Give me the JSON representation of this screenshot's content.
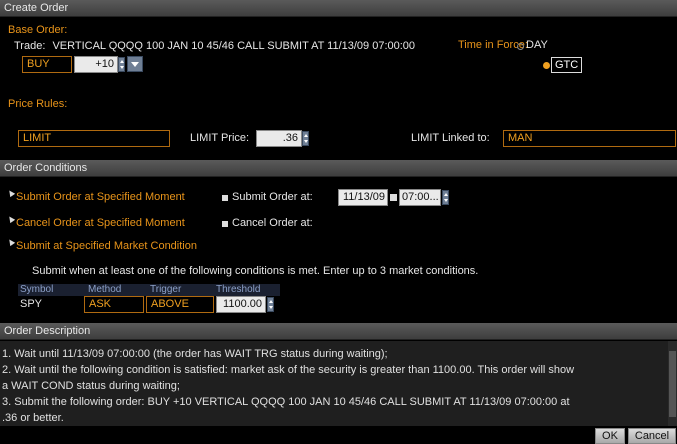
{
  "window": {
    "title": "Create Order"
  },
  "base_order": {
    "section_label": "Base Order:",
    "trade_label": "Trade:",
    "trade_text": "VERTICAL QQQQ 100 JAN 10 45/46 CALL SUBMIT AT 11/13/09 07:00:00",
    "action": "BUY",
    "quantity": "+10",
    "time_in_force_label": "Time in Force:",
    "tif_options": [
      "DAY",
      "GTC"
    ],
    "tif_selected": "GTC"
  },
  "price_rules": {
    "section_label": "Price Rules:",
    "order_type": "LIMIT",
    "limit_price_label": "LIMIT Price:",
    "limit_price": ".36",
    "linked_label": "LIMIT Linked to:",
    "linked_value": "MAN"
  },
  "order_conditions": {
    "title": "Order Conditions",
    "submit_at_moment": "Submit Order at Specified Moment",
    "submit_order_at_label": "Submit Order at:",
    "submit_date": "11/13/09",
    "submit_time": "07:00...",
    "cancel_at_moment": "Cancel Order at Specified Moment",
    "cancel_order_at_label": "Cancel Order at:",
    "submit_market_condition": "Submit at Specified Market Condition",
    "condition_instructions": "Submit when at least one of the following conditions is met. Enter up to 3 market conditions.",
    "table_headers": [
      "Symbol",
      "Method",
      "Trigger",
      "Threshold"
    ],
    "table_rows": [
      {
        "symbol": "SPY",
        "method": "ASK",
        "trigger": "ABOVE",
        "threshold": "1100.00"
      }
    ]
  },
  "order_description": {
    "title": "Order Description",
    "lines": [
      "1.  Wait until 11/13/09 07:00:00 (the order has WAIT TRG status during waiting);",
      "2.  Wait until the following condition is satisfied: market ask of the security is greater than 1100.00. This order will show",
      "a WAIT COND status during waiting;",
      "3.  Submit the following order: BUY +10 VERTICAL QQQQ 100 JAN 10 45/46 CALL SUBMIT AT 11/13/09 07:00:00 at",
      ".36 or better."
    ]
  },
  "buttons": {
    "ok": "OK",
    "cancel": "Cancel"
  },
  "colors": {
    "accent": "#e8941a",
    "header_bg": "#4a4a4a",
    "selected_radio": "#f0a020"
  }
}
